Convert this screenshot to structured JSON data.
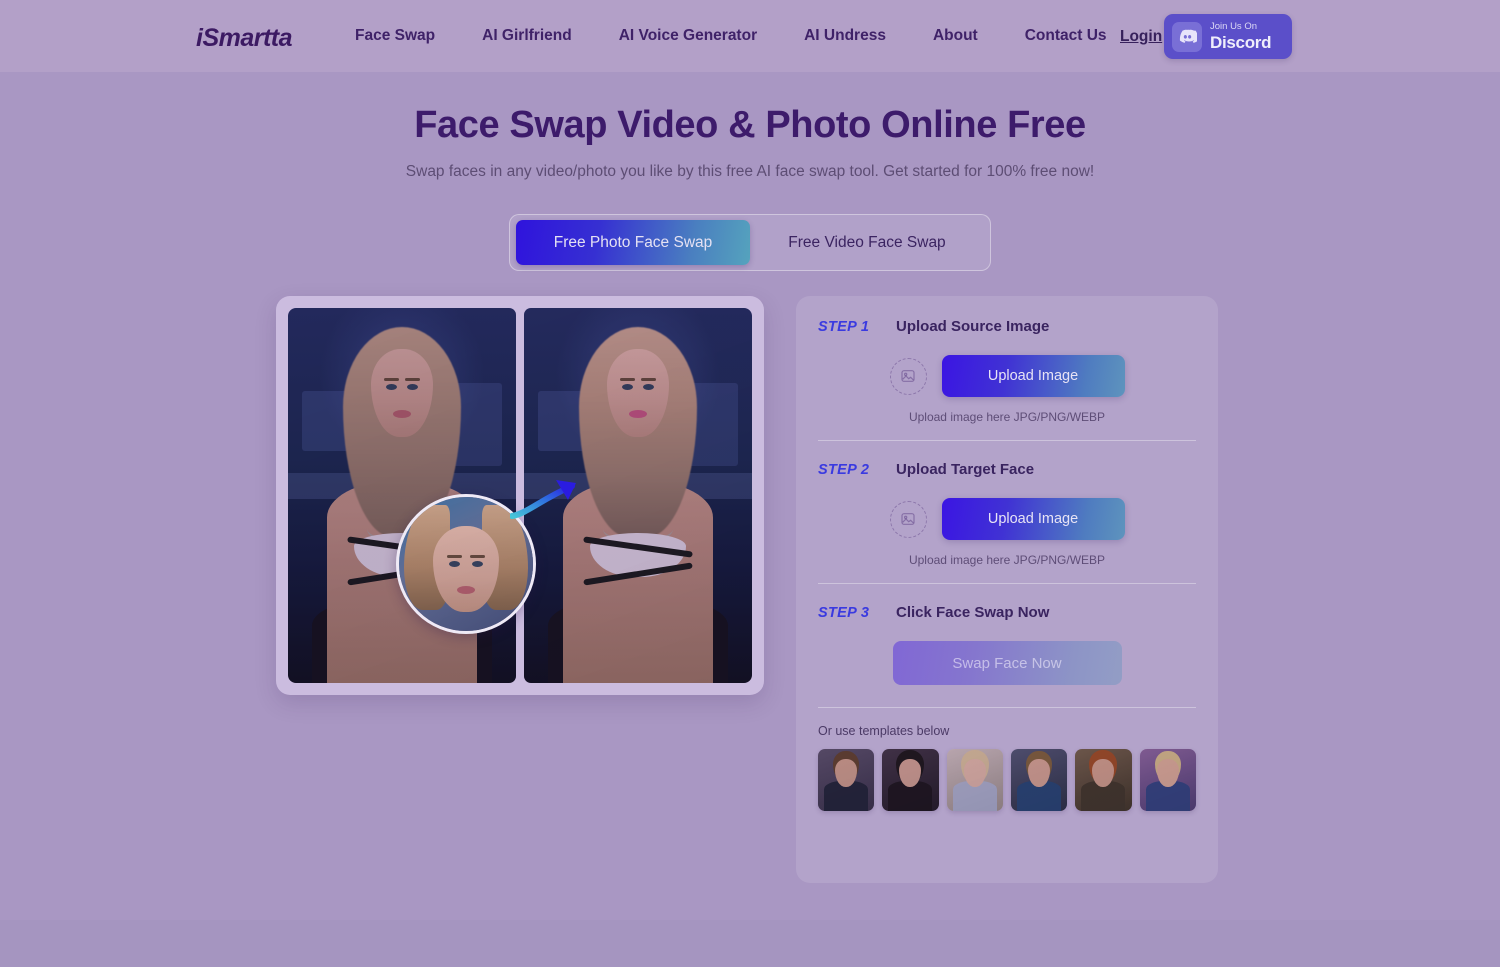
{
  "navbar": {
    "logo": "iSmartta",
    "links": [
      {
        "label": "Face Swap"
      },
      {
        "label": "AI Girlfriend"
      },
      {
        "label": "AI Voice Generator"
      },
      {
        "label": "AI Undress"
      },
      {
        "label": "About"
      },
      {
        "label": "Contact Us"
      }
    ],
    "login_label": "Login",
    "discord": {
      "small_label": "Join Us On",
      "big_label": "Discord",
      "icon": "discord-icon",
      "bg_color": "#5b4fc9"
    }
  },
  "hero": {
    "title": "Face Swap Video & Photo Online Free",
    "subtitle": "Swap faces in any video/photo you like by this free AI face swap tool. Get started for 100% free now!",
    "title_color": "#3d1b6b"
  },
  "tabs": [
    {
      "label": "Free Photo Face Swap",
      "active": true
    },
    {
      "label": "Free Video Face Swap",
      "active": false
    }
  ],
  "demo": {
    "before_alt": "before-face-swap-photo",
    "after_alt": "after-face-swap-photo",
    "inset_alt": "source-face-thumbnail",
    "arrow_alt": "swap-arrow"
  },
  "steps": [
    {
      "number": "STEP 1",
      "title": "Upload Source Image",
      "button_label": "Upload Image",
      "hint": "Upload image here JPG/PNG/WEBP",
      "drop_icon": "image-placeholder-icon"
    },
    {
      "number": "STEP 2",
      "title": "Upload Target Face",
      "button_label": "Upload Image",
      "hint": "Upload image here JPG/PNG/WEBP",
      "drop_icon": "image-placeholder-icon"
    },
    {
      "number": "STEP 3",
      "title": "Click Face Swap Now",
      "button_label": "Swap Face Now",
      "disabled": true
    }
  ],
  "templates": {
    "label": "Or use templates below",
    "items": [
      {
        "name": "template-1-brunette-schoolgirl",
        "bg": "#534a60",
        "hair": "#6a4a35",
        "skin": "#d9ad90",
        "body": "#2a2c40"
      },
      {
        "name": "template-2-dark-haired-woman",
        "bg": "#3a2f3f",
        "hair": "#241c22",
        "skin": "#dcb096",
        "body": "#241b25"
      },
      {
        "name": "template-3-blonde-woman",
        "bg": "#c8bfb2",
        "hair": "#e3cf9f",
        "skin": "#ecc7ab",
        "body": "#b9c3cf"
      },
      {
        "name": "template-4-captain-america",
        "bg": "#4a4e63",
        "hair": "#8a6b43",
        "skin": "#e0b396",
        "body": "#2f4f7a"
      },
      {
        "name": "template-5-warrior-woman",
        "bg": "#6b5945",
        "hair": "#a8562c",
        "skin": "#dcae8f",
        "body": "#4b4032"
      },
      {
        "name": "template-6-blonde-athlete",
        "bg": "#7e5f8e",
        "hair": "#e0cc8e",
        "skin": "#e8bd9c",
        "body": "#3c4e86"
      }
    ]
  },
  "colors": {
    "page_bg": "#a997c3",
    "navbar_bg": "#b3a0c8",
    "accent_gradient_start": "#3b15e3",
    "accent_gradient_end": "#5e94bd",
    "step_number_color": "#3a3ae0"
  }
}
